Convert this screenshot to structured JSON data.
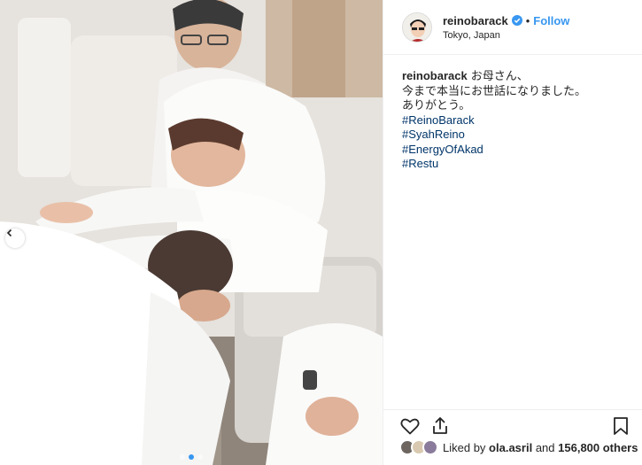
{
  "post": {
    "username": "reinobarack",
    "follow_label": "Follow",
    "separator": "•",
    "location": "Tokyo, Japan"
  },
  "caption": {
    "username": "reinobarack",
    "line1": "お母さん、",
    "line2": "今まで本当にお世話になりました。",
    "line3": "ありがとう。",
    "hashtags": [
      "#ReinoBarack",
      "#SyahReino",
      "#EnergyOfAkad",
      "#Restu"
    ]
  },
  "likes": {
    "prefix": "Liked by",
    "user": "ola.asril",
    "and": "and",
    "count": "156,800 others"
  },
  "icons": {
    "verified": "verified-badge-icon",
    "like": "heart-icon",
    "share": "share-icon",
    "save": "bookmark-icon",
    "prev": "chevron-left-icon"
  },
  "colors": {
    "link": "#3897f0",
    "hashtag": "#003569",
    "border": "#efefef"
  },
  "carousel": {
    "total": 3,
    "active": 2
  }
}
